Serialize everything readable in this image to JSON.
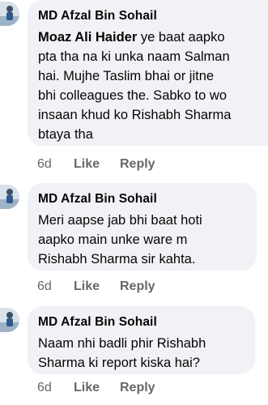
{
  "comments": [
    {
      "author": "MD Afzal Bin Sohail",
      "mention": "Moaz Ali Haider",
      "lines": [
        " ye baat aapko",
        "pta tha na ki unka naam Salman",
        "hai. Mujhe Taslim bhai or jitne",
        "bhi colleagues the. Sabko to wo",
        "insaan khud ko Rishabh Sharma",
        "btaya tha"
      ],
      "age": "6d",
      "like_label": "Like",
      "reply_label": "Reply"
    },
    {
      "author": "MD Afzal Bin Sohail",
      "lines": [
        "Meri aapse jab bhi baat hoti",
        "aapko main unke ware m",
        "Rishabh Sharma sir kahta."
      ],
      "age": "6d",
      "like_label": "Like",
      "reply_label": "Reply"
    },
    {
      "author": "MD Afzal Bin Sohail",
      "lines": [
        "Naam nhi badli phir Rishabh",
        "Sharma ki report kiska hai?"
      ],
      "age": "6d",
      "like_label": "Like",
      "reply_label": "Reply"
    }
  ],
  "colors": {
    "bubble": "#f0f2f5",
    "text": "#050505",
    "meta": "#65676b"
  },
  "icons": {
    "avatar": "profile-photo-avatar-icon"
  }
}
